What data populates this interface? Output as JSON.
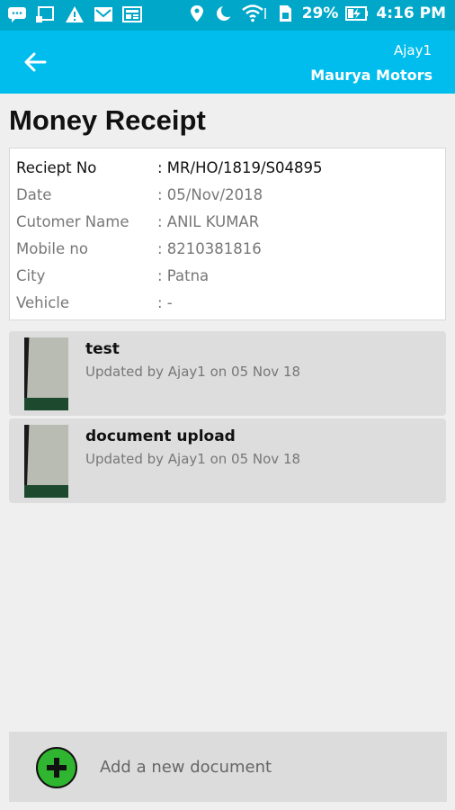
{
  "status_bar": {
    "battery": "29%",
    "time": "4:16 PM",
    "icons_left": [
      "message-icon",
      "cast-icon",
      "warning-icon",
      "gmail-icon",
      "news-icon"
    ],
    "icons_right": [
      "location-icon",
      "moon-icon",
      "wifi-icon",
      "sim-icon",
      "battery-icon"
    ]
  },
  "app_bar": {
    "user": "Ajay1",
    "company": "Maurya Motors"
  },
  "page": {
    "title": "Money Receipt"
  },
  "receipt": {
    "rows": [
      {
        "label": "Reciept No",
        "value": ": MR/HO/1819/S04895"
      },
      {
        "label": "Date",
        "value": ": 05/Nov/2018"
      },
      {
        "label": "Cutomer Name",
        "value": ": ANIL KUMAR"
      },
      {
        "label": "Mobile no",
        "value": ": 8210381816"
      },
      {
        "label": "City",
        "value": ": Patna"
      },
      {
        "label": "Vehicle",
        "value": ": -"
      }
    ]
  },
  "documents": [
    {
      "title": "test",
      "subtitle": "Updated by Ajay1 on 05 Nov 18"
    },
    {
      "title": "document upload",
      "subtitle": "Updated by Ajay1 on 05 Nov 18"
    }
  ],
  "add_document": {
    "label": "Add a new document"
  },
  "colors": {
    "status_bar": "#00a7c9",
    "app_bar": "#00bdee",
    "add_icon": "#2fb52f"
  }
}
